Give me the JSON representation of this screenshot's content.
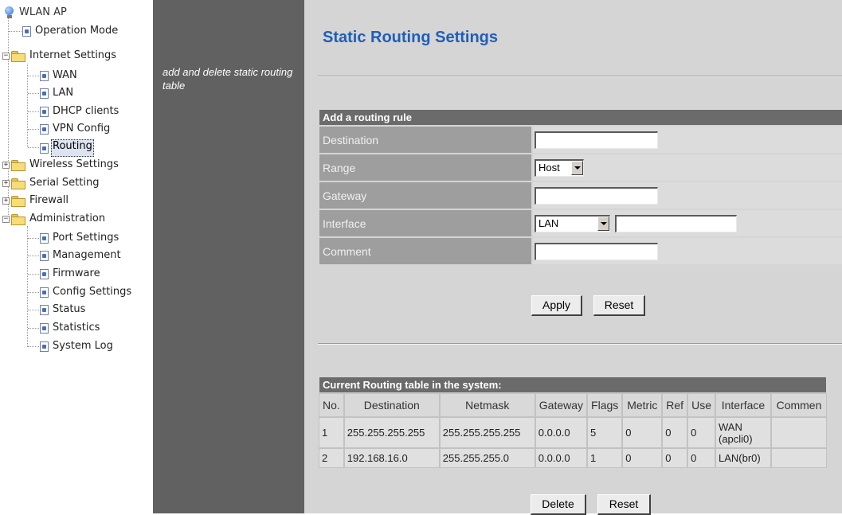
{
  "tree": {
    "root": "WLAN AP",
    "items": [
      {
        "label": "Operation Mode",
        "kind": "page",
        "level": 1
      },
      {
        "label": "Internet Settings",
        "kind": "folder",
        "level": 1,
        "expanded": true
      },
      {
        "label": "WAN",
        "kind": "page",
        "level": 2
      },
      {
        "label": "LAN",
        "kind": "page",
        "level": 2
      },
      {
        "label": "DHCP clients",
        "kind": "page",
        "level": 2
      },
      {
        "label": "VPN Config",
        "kind": "page",
        "level": 2
      },
      {
        "label": "Routing",
        "kind": "page",
        "level": 2,
        "selected": true
      },
      {
        "label": "Wireless Settings",
        "kind": "folder",
        "level": 1,
        "expanded": false
      },
      {
        "label": "Serial Setting",
        "kind": "folder",
        "level": 1,
        "expanded": false
      },
      {
        "label": "Firewall",
        "kind": "folder",
        "level": 1,
        "expanded": false
      },
      {
        "label": "Administration",
        "kind": "folder",
        "level": 1,
        "expanded": true
      },
      {
        "label": "Port Settings",
        "kind": "page",
        "level": 2
      },
      {
        "label": "Management",
        "kind": "page",
        "level": 2
      },
      {
        "label": "Firmware",
        "kind": "page",
        "level": 2
      },
      {
        "label": "Config Settings",
        "kind": "page",
        "level": 2
      },
      {
        "label": "Status",
        "kind": "page",
        "level": 2
      },
      {
        "label": "Statistics",
        "kind": "page",
        "level": 2
      },
      {
        "label": "System Log",
        "kind": "page",
        "level": 2
      }
    ]
  },
  "description": "add and delete static routing table",
  "page": {
    "title": "Static Routing Settings"
  },
  "add_rule": {
    "header": "Add a routing rule",
    "destination_label": "Destination",
    "destination_value": "",
    "range_label": "Range",
    "range_value": "Host",
    "gateway_label": "Gateway",
    "gateway_value": "",
    "interface_label": "Interface",
    "interface_value": "LAN",
    "interface_custom_value": "",
    "comment_label": "Comment",
    "comment_value": "",
    "apply_label": "Apply",
    "reset_label": "Reset"
  },
  "routing_table": {
    "header": "Current Routing table in the system:",
    "columns": [
      "No.",
      "Destination",
      "Netmask",
      "Gateway",
      "Flags",
      "Metric",
      "Ref",
      "Use",
      "Interface",
      "Commen"
    ],
    "rows": [
      {
        "no": "1",
        "destination": "255.255.255.255",
        "netmask": "255.255.255.255",
        "gateway": "0.0.0.0",
        "flags": "5",
        "metric": "0",
        "ref": "0",
        "use": "0",
        "interface": "WAN (apcli0)",
        "comment": ""
      },
      {
        "no": "2",
        "destination": "192.168.16.0",
        "netmask": "255.255.255.0",
        "gateway": "0.0.0.0",
        "flags": "1",
        "metric": "0",
        "ref": "0",
        "use": "0",
        "interface": "LAN(br0)",
        "comment": ""
      }
    ],
    "delete_label": "Delete",
    "reset_label": "Reset"
  },
  "colors": {
    "title": "#1d5fb8",
    "desc_bg": "#616161",
    "main_bg": "#d5d5d5",
    "header_bg": "#6b6b6b",
    "label_bg": "#9e9e9e"
  }
}
